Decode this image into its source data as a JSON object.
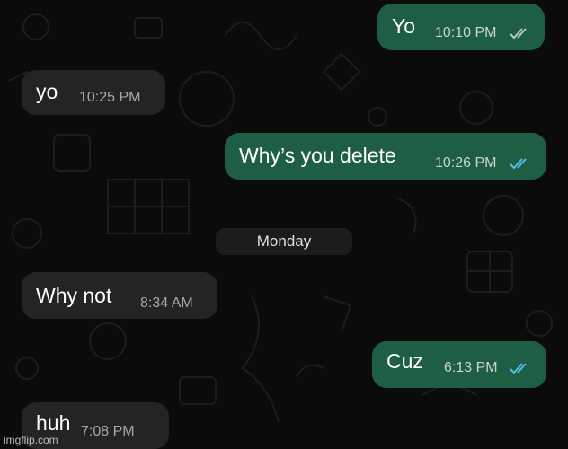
{
  "messages": [
    {
      "text": "Yo",
      "time": "10:10 PM",
      "direction": "outgoing",
      "read": "grey"
    },
    {
      "text": "yo",
      "time": "10:25 PM",
      "direction": "incoming"
    },
    {
      "text": "Why’s you delete",
      "time": "10:26 PM",
      "direction": "outgoing",
      "read": "blue"
    },
    {
      "text": "Why not",
      "time": "8:34 AM",
      "direction": "incoming"
    },
    {
      "text": "Cuz",
      "time": "6:13 PM",
      "direction": "outgoing",
      "read": "blue"
    },
    {
      "text": "huh",
      "time": "7:08 PM",
      "direction": "incoming"
    }
  ],
  "date_separator": "Monday",
  "watermark": "imgflip.com",
  "colors": {
    "outgoing_bubble": "#1e5e45",
    "incoming_bubble": "#242424",
    "read_tick_blue": "#53bdeb",
    "delivered_tick_grey": "#b8c4be",
    "background": "#0b0b0b"
  }
}
